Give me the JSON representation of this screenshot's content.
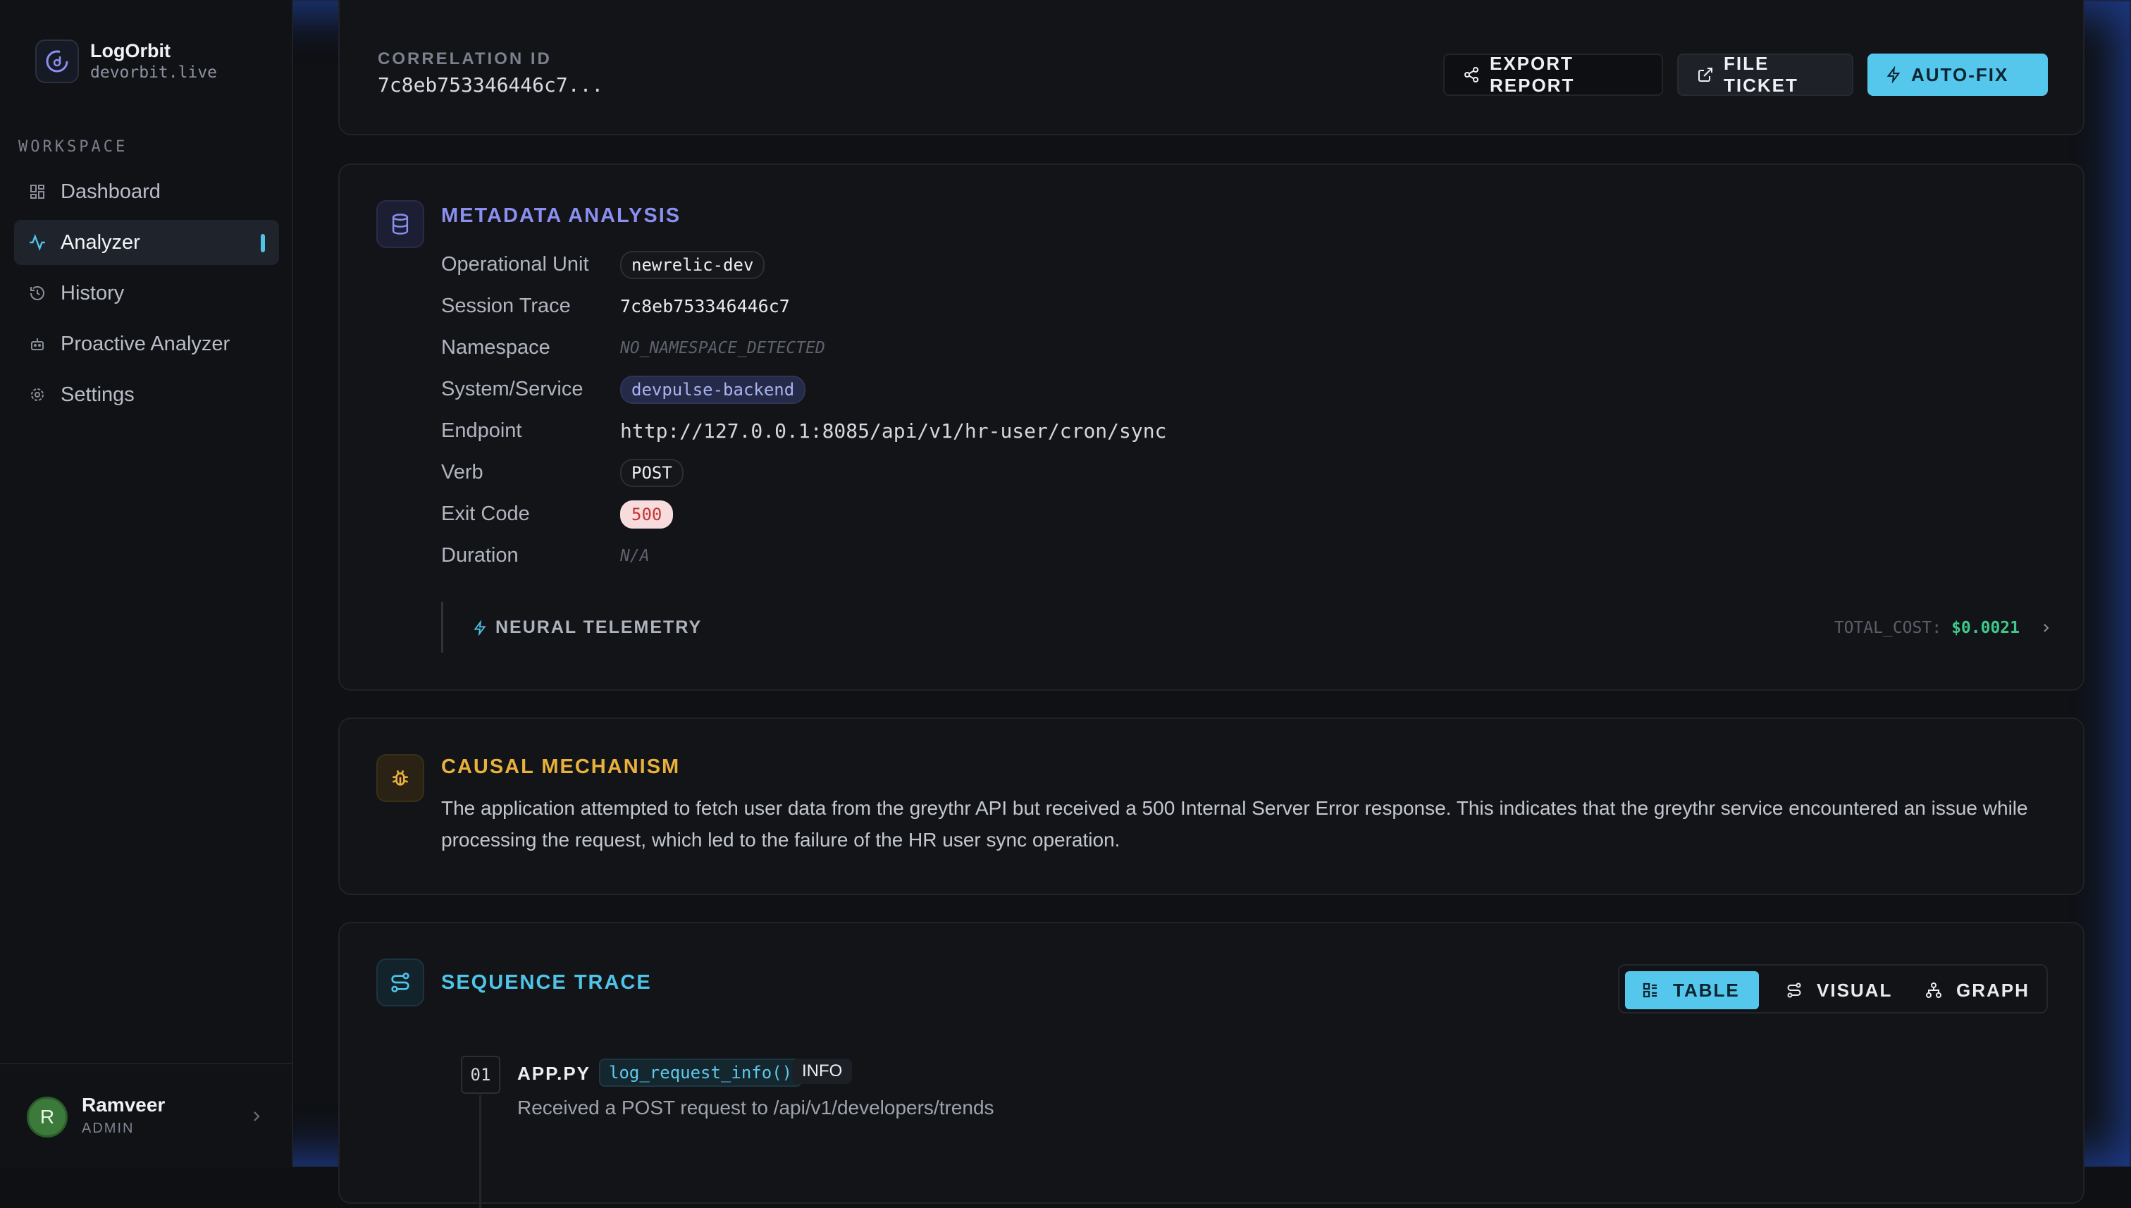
{
  "brand": {
    "name": "LogOrbit",
    "domain": "devorbit.live"
  },
  "sidebar": {
    "section_label": "WORKSPACE",
    "items": [
      {
        "label": "Dashboard",
        "icon": "grid-icon",
        "active": false
      },
      {
        "label": "Analyzer",
        "icon": "activity-icon",
        "active": true
      },
      {
        "label": "History",
        "icon": "history-icon",
        "active": false
      },
      {
        "label": "Proactive Analyzer",
        "icon": "bot-icon",
        "active": false
      },
      {
        "label": "Settings",
        "icon": "gear-icon",
        "active": false
      }
    ],
    "user": {
      "initial": "R",
      "name": "Ramveer",
      "role": "ADMIN"
    }
  },
  "header": {
    "correlation_label": "CORRELATION ID",
    "correlation_value": "7c8eb753346446c7...",
    "buttons": {
      "export": "EXPORT REPORT",
      "ticket": "FILE TICKET",
      "autofix": "AUTO-FIX"
    }
  },
  "metadata": {
    "title": "METADATA ANALYSIS",
    "rows": [
      {
        "key": "Operational Unit",
        "value": "newrelic-dev"
      },
      {
        "key": "Session Trace",
        "value": "7c8eb753346446c7"
      },
      {
        "key": "Namespace",
        "value": "NO_NAMESPACE_DETECTED"
      },
      {
        "key": "System/Service",
        "value": "devpulse-backend"
      },
      {
        "key": "Endpoint",
        "value": "http://127.0.0.1:8085/api/v1/hr-user/cron/sync"
      },
      {
        "key": "Verb",
        "value": "POST"
      },
      {
        "key": "Exit Code",
        "value": "500"
      },
      {
        "key": "Duration",
        "value": "N/A"
      }
    ],
    "telemetry": {
      "label": "NEURAL TELEMETRY",
      "cost_label": "TOTAL_COST:",
      "cost_value": "$0.0021"
    }
  },
  "causal": {
    "title": "CAUSAL MECHANISM",
    "text": "The application attempted to fetch user data from the greythr API but received a 500 Internal Server Error response. This indicates that the greythr service encountered an issue while processing the request, which led to the failure of the HR user sync operation."
  },
  "sequence": {
    "title": "SEQUENCE TRACE",
    "views": {
      "table": "TABLE",
      "visual": "VISUAL",
      "graph": "GRAPH"
    },
    "steps": [
      {
        "num": "01",
        "file": "APP.PY",
        "function": "log_request_info()",
        "level": "INFO",
        "message": "Received a POST request to /api/v1/developers/trends"
      }
    ]
  },
  "colors": {
    "accent": "#55c7ec",
    "metadata": "#8b8ff0",
    "causal": "#e9b13b",
    "sequence": "#4fc3e8",
    "success": "#3ec98a",
    "error": "#c53434"
  }
}
